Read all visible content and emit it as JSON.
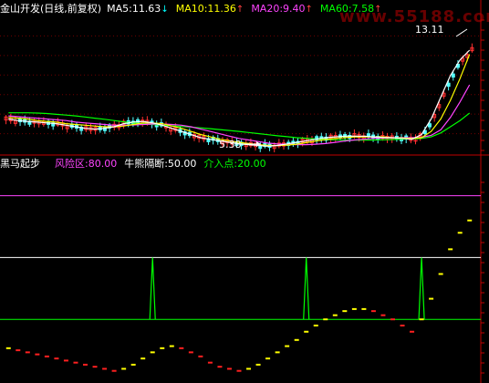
{
  "top_panel": {
    "title": "金山开发(日线,前复权)",
    "ma_labels": [
      {
        "text": "MA5:11.63",
        "arrow": "↓",
        "color": "#ffffff",
        "arrow_color": "#00ffff"
      },
      {
        "text": "MA10:11.36",
        "arrow": "↑",
        "color": "#ffff00",
        "arrow_color": "#ff4040"
      },
      {
        "text": "MA20:9.40",
        "arrow": "↑",
        "color": "#ff44ff",
        "arrow_color": "#ff4040"
      },
      {
        "text": "MA60:7.58",
        "arrow": "↑",
        "color": "#00ff00",
        "arrow_color": "#ff4040"
      }
    ],
    "high_note": "13.11",
    "low_note": "5.38"
  },
  "watermark": "www.55188.com",
  "bottom_panel": {
    "title": "黑马起步",
    "labels": [
      {
        "text": "风险区:80.00",
        "color": "#ff44ff"
      },
      {
        "text": "牛熊隔断:50.00",
        "color": "#ffffff"
      },
      {
        "text": "介入点:20.00",
        "color": "#00ff00"
      }
    ]
  },
  "colors": {
    "background": "#000000",
    "border": "#c00000",
    "up_candle": "#ff3030",
    "down_candle": "#54ffff",
    "ma5": "#ffffff",
    "ma10": "#ffff00",
    "ma20": "#ff44ff",
    "ma60": "#00ff00",
    "indicator_up": "#ffff00",
    "indicator_down": "#ff2020",
    "signal_line": "#00ff00"
  },
  "chart_data": [
    {
      "type": "line",
      "series": [
        {
          "name": "MA5",
          "values": [
            7.2,
            7.1,
            7.05,
            7.0,
            6.95,
            6.9,
            6.8,
            6.7,
            6.6,
            6.55,
            6.6,
            6.7,
            6.9,
            7.0,
            7.05,
            6.95,
            6.8,
            6.6,
            6.4,
            6.2,
            6.0,
            5.9,
            5.8,
            5.7,
            5.6,
            5.55,
            5.5,
            5.45,
            5.5,
            5.6,
            5.7,
            5.8,
            5.9,
            6.0,
            6.05,
            6.1,
            6.1,
            6.1,
            6.05,
            6.0,
            6.0,
            5.95,
            5.9,
            6.2,
            7.2,
            8.6,
            10.0,
            11.0,
            11.63
          ]
        },
        {
          "name": "MA10",
          "values": [
            7.3,
            7.25,
            7.2,
            7.1,
            7.05,
            7.0,
            6.9,
            6.85,
            6.8,
            6.75,
            6.7,
            6.7,
            6.75,
            6.85,
            6.95,
            6.95,
            6.9,
            6.75,
            6.6,
            6.4,
            6.2,
            6.05,
            5.9,
            5.8,
            5.7,
            5.62,
            5.55,
            5.5,
            5.5,
            5.52,
            5.58,
            5.68,
            5.78,
            5.88,
            5.95,
            6.0,
            6.05,
            6.05,
            6.05,
            6.05,
            6.0,
            5.98,
            5.95,
            6.0,
            6.4,
            7.2,
            8.4,
            9.8,
            11.36
          ]
        },
        {
          "name": "MA20",
          "values": [
            7.4,
            7.35,
            7.3,
            7.25,
            7.2,
            7.15,
            7.1,
            7.0,
            6.95,
            6.9,
            6.85,
            6.8,
            6.8,
            6.82,
            6.85,
            6.88,
            6.88,
            6.85,
            6.8,
            6.7,
            6.55,
            6.4,
            6.25,
            6.1,
            5.95,
            5.85,
            5.75,
            5.65,
            5.6,
            5.58,
            5.55,
            5.55,
            5.58,
            5.62,
            5.7,
            5.78,
            5.85,
            5.9,
            5.95,
            5.98,
            6.0,
            6.0,
            6.0,
            6.02,
            6.15,
            6.5,
            7.3,
            8.3,
            9.4
          ]
        },
        {
          "name": "MA60",
          "values": [
            7.6,
            7.6,
            7.6,
            7.58,
            7.55,
            7.5,
            7.45,
            7.4,
            7.33,
            7.25,
            7.18,
            7.1,
            7.02,
            6.95,
            6.9,
            6.85,
            6.8,
            6.76,
            6.72,
            6.68,
            6.63,
            6.58,
            6.52,
            6.46,
            6.4,
            6.33,
            6.26,
            6.19,
            6.12,
            6.06,
            6.0,
            5.96,
            5.92,
            5.88,
            5.86,
            5.84,
            5.84,
            5.84,
            5.85,
            5.86,
            5.88,
            5.9,
            5.92,
            5.95,
            6.05,
            6.3,
            6.7,
            7.1,
            7.58
          ]
        }
      ],
      "annotations": [
        {
          "text": "13.11"
        },
        {
          "text": "5.38"
        }
      ],
      "ylim": [
        5.0,
        13.8
      ]
    },
    {
      "type": "line",
      "title": "黑马起步",
      "reference_lines": [
        {
          "name": "风险区",
          "value": 80.0
        },
        {
          "name": "牛熊隔断",
          "value": 50.0
        },
        {
          "name": "介入点",
          "value": 20.0
        }
      ],
      "series": [
        {
          "name": "indicator",
          "values": [
            6,
            5,
            4,
            3,
            2,
            1,
            0,
            -1,
            -2,
            -3,
            -4,
            -5,
            -4,
            -2,
            1,
            4,
            6,
            7,
            6,
            4,
            2,
            -1,
            -3,
            -4,
            -5,
            -4,
            -2,
            1,
            4,
            7,
            10,
            14,
            17,
            20,
            22,
            24,
            25,
            25,
            24,
            22,
            20,
            17,
            14,
            20,
            30,
            42,
            54,
            62,
            68
          ]
        },
        {
          "name": "signal",
          "values": [
            0,
            0,
            0,
            0,
            0,
            0,
            0,
            0,
            0,
            0,
            0,
            0,
            0,
            0,
            0,
            30,
            0,
            0,
            0,
            0,
            0,
            0,
            0,
            0,
            0,
            0,
            0,
            0,
            0,
            0,
            0,
            30,
            0,
            0,
            0,
            0,
            0,
            0,
            0,
            0,
            0,
            0,
            0,
            30,
            0,
            0,
            0,
            0,
            0
          ]
        }
      ],
      "ylim": [
        -10,
        90
      ]
    }
  ]
}
